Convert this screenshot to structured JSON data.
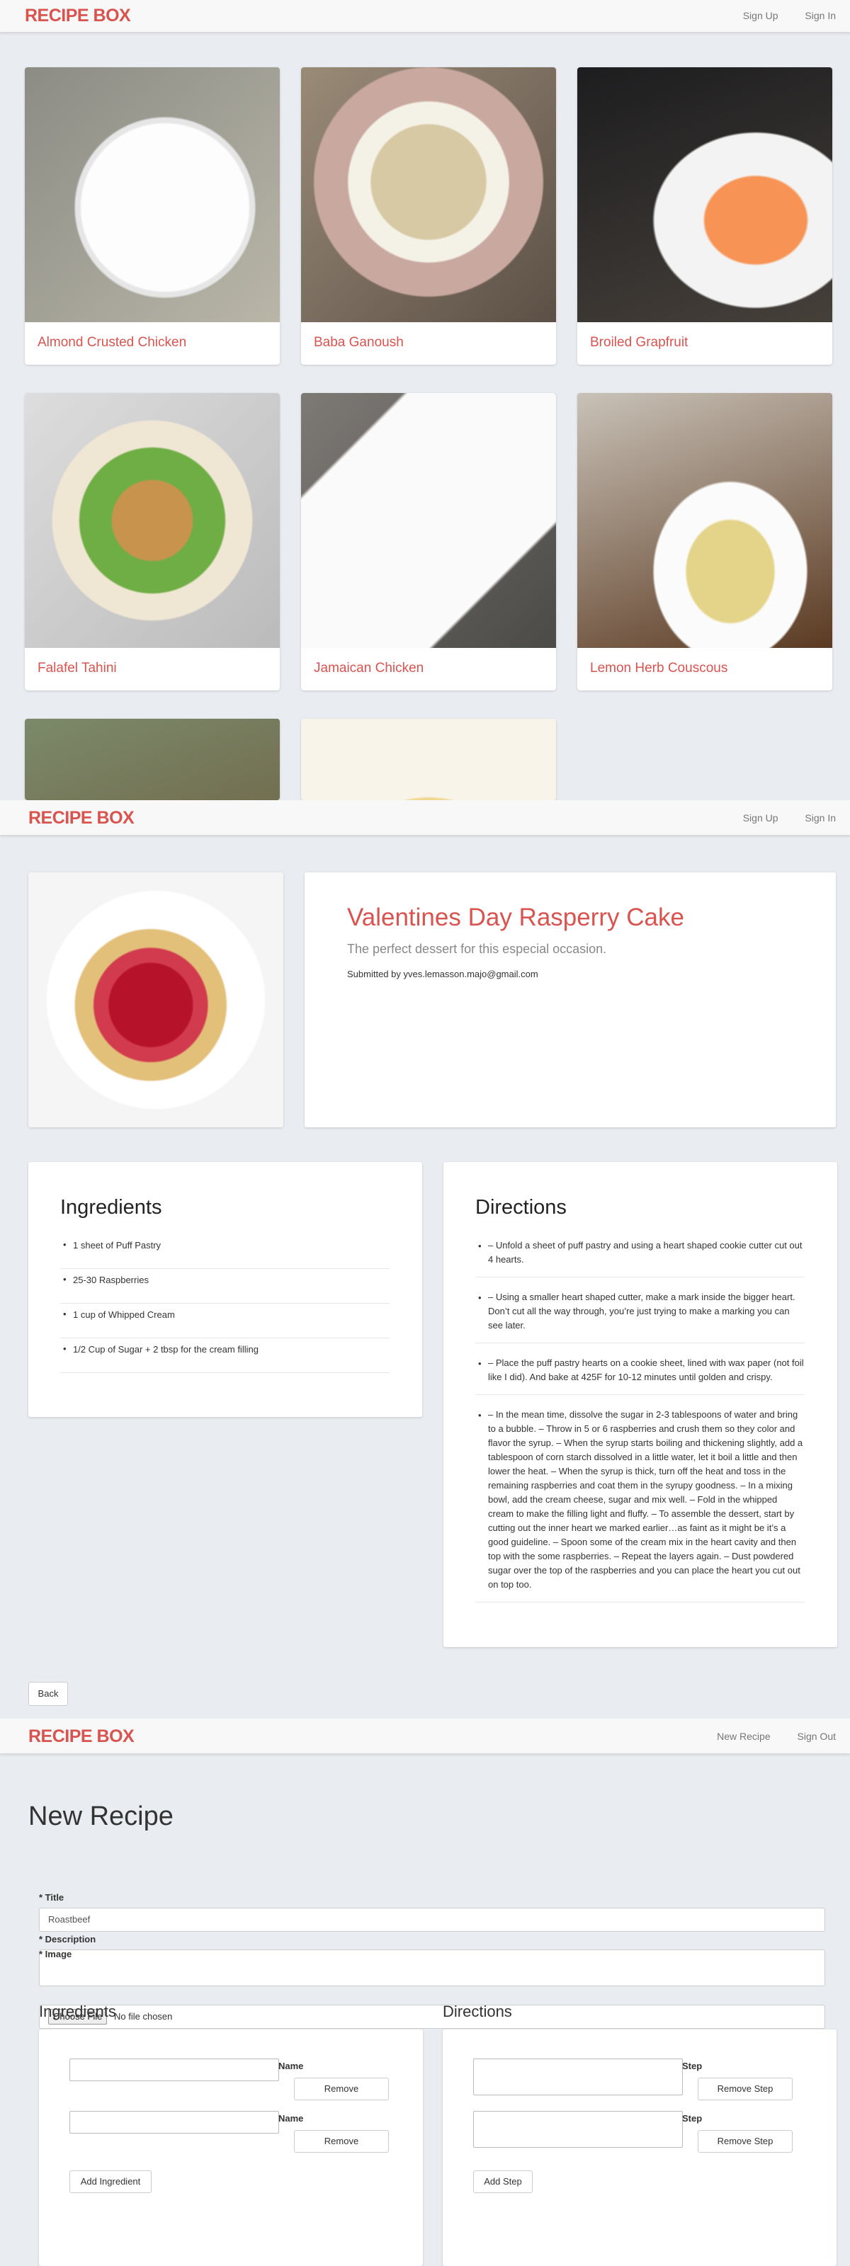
{
  "nav1": {
    "brand": "RECIPE BOX",
    "links": [
      "Sign Up",
      "Sign In"
    ]
  },
  "recipes": [
    {
      "title": "Almond Crusted Chicken"
    },
    {
      "title": "Baba Ganoush"
    },
    {
      "title": "Broiled Grapfruit"
    },
    {
      "title": "Falafel Tahini"
    },
    {
      "title": "Jamaican Chicken"
    },
    {
      "title": "Lemon Herb Couscous"
    }
  ],
  "nav2": {
    "brand": "RECIPE BOX",
    "links": [
      "Sign Up",
      "Sign In"
    ]
  },
  "detail": {
    "title": "Valentines Day Rasperry Cake",
    "description": "The perfect dessert for this especial occasion.",
    "submitted": "Submitted by yves.lemasson.majo@gmail.com",
    "ingredients_heading": "Ingredients",
    "ingredients": [
      "1 sheet of Puff Pastry",
      "25-30 Raspberries",
      "1 cup of Whipped Cream",
      "1/2 Cup of Sugar + 2 tbsp for the cream filling"
    ],
    "directions_heading": "Directions",
    "directions": [
      "– Unfold a sheet of puff pastry and using a heart shaped cookie cutter cut out 4 hearts.",
      "– Using a smaller heart shaped cutter, make a mark inside the bigger heart. Don’t cut all the way through, you’re just trying to make a marking you can see later.",
      "– Place the puff pastry hearts on a cookie sheet, lined with wax paper (not foil like I did). And bake at 425F for 10-12 minutes until golden and crispy.",
      "– In the mean time, dissolve the sugar in 2-3 tablespoons of water and bring to a bubble. – Throw in 5 or 6 raspberries and crush them so they color and flavor the syrup. – When the syrup starts boiling and thickening slightly, add a tablespoon of corn starch dissolved in a little water, let it boil a little and then lower the heat. – When the syrup is thick, turn off the heat and toss in the remaining raspberries and coat them in the syrupy goodness. – In a mixing bowl, add the cream cheese, sugar and mix well. – Fold in the whipped cream to make the filling light and fluffy. – To assemble the dessert, start by cutting out the inner heart we marked earlier…as faint as it might be it’s a good guideline. – Spoon some of the cream mix in the heart cavity and then top with the some raspberries. – Repeat the layers again. – Dust powdered sugar over the top of the raspberries and you can place the heart you cut out on top too."
    ],
    "back_label": "Back"
  },
  "nav3": {
    "brand": "RECIPE BOX",
    "links": [
      "New Recipe",
      "Sign Out"
    ]
  },
  "form": {
    "heading": "New Recipe",
    "title_label": "* Title",
    "title_value": "Roastbeef",
    "description_label": "* Description",
    "image_label": "* Image",
    "choose_file": "Choose File",
    "no_file": "No file chosen",
    "ingredients_heading": "Ingredients",
    "directions_heading": "Directions",
    "name_label": "Name",
    "step_label": "Step",
    "remove_label": "Remove",
    "remove_step_label": "Remove Step",
    "add_ingredient": "Add Ingredient",
    "add_step": "Add Step"
  }
}
